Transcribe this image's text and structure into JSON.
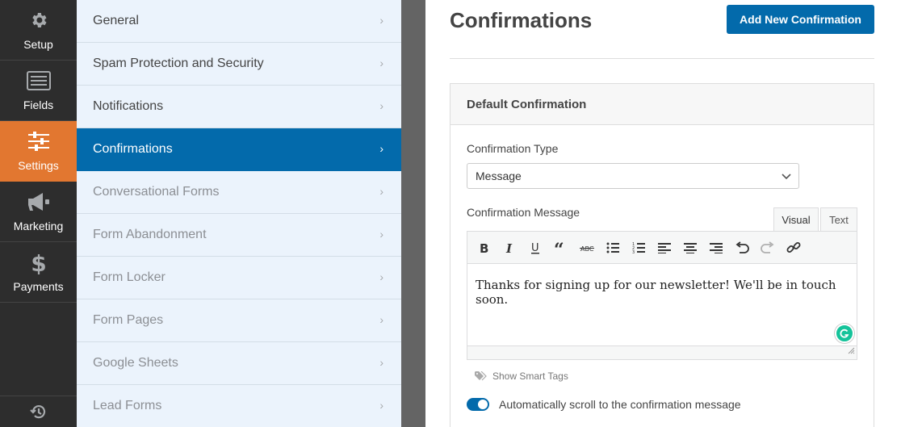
{
  "rail": {
    "items": [
      {
        "label": "Setup",
        "icon": "gear-icon"
      },
      {
        "label": "Fields",
        "icon": "list-icon"
      },
      {
        "label": "Settings",
        "icon": "sliders-icon"
      },
      {
        "label": "Marketing",
        "icon": "megaphone-icon"
      },
      {
        "label": "Payments",
        "icon": "dollar-icon"
      }
    ],
    "active": "Settings",
    "footer_icon": "revision-history-icon"
  },
  "submenu": {
    "items": [
      {
        "label": "General"
      },
      {
        "label": "Spam Protection and Security"
      },
      {
        "label": "Notifications"
      },
      {
        "label": "Confirmations"
      },
      {
        "label": "Conversational Forms"
      },
      {
        "label": "Form Abandonment"
      },
      {
        "label": "Form Locker"
      },
      {
        "label": "Form Pages"
      },
      {
        "label": "Google Sheets"
      },
      {
        "label": "Lead Forms"
      }
    ],
    "active": "Confirmations",
    "chevron": "›"
  },
  "main": {
    "title": "Confirmations",
    "add_button": "Add New Confirmation",
    "panel": {
      "title": "Default Confirmation",
      "type_label": "Confirmation Type",
      "type_value": "Message",
      "message_label": "Confirmation Message",
      "tabs": {
        "visual": "Visual",
        "text": "Text"
      },
      "active_tab": "Visual",
      "message": "Thanks for signing up for our newsletter! We'll be in touch soon.",
      "smart_tags": "Show Smart Tags",
      "auto_scroll_label": "Automatically scroll to the confirmation message",
      "auto_scroll_enabled": true
    }
  },
  "colors": {
    "accent": "#036aab",
    "settings_active": "#e27730",
    "rail_bg": "#2d2d2d",
    "submenu_bg": "#ebf3fc"
  }
}
